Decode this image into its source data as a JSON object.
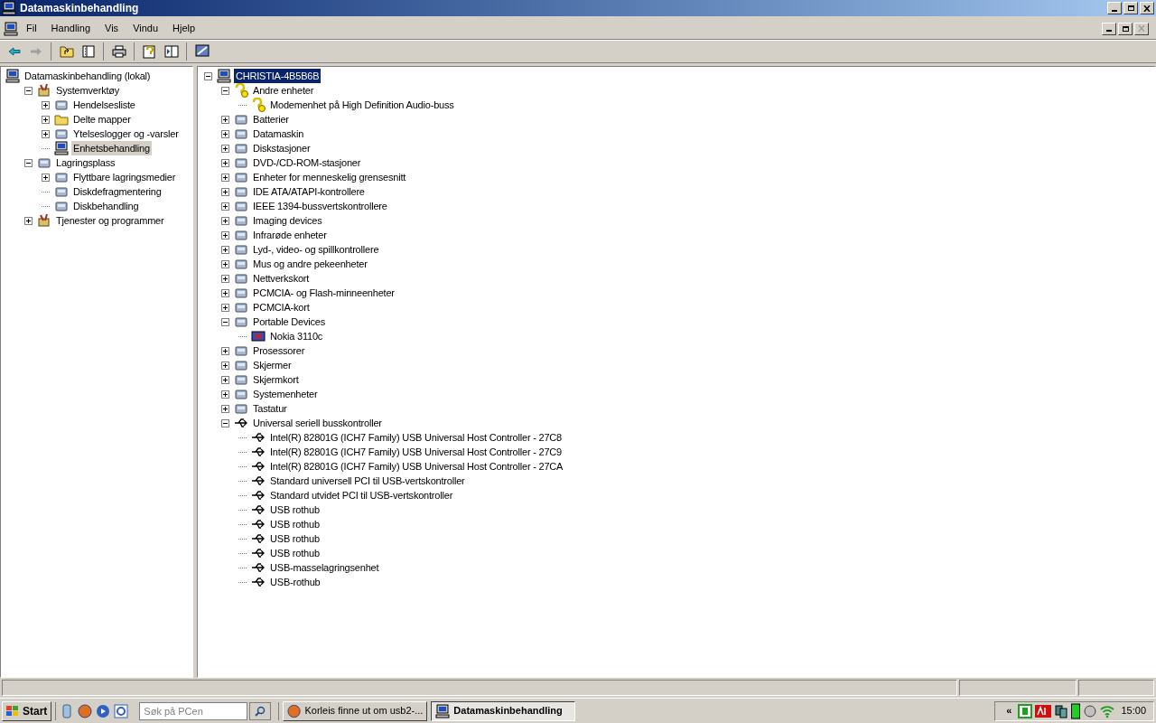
{
  "window": {
    "title": "Datamaskinbehandling"
  },
  "menu": [
    "Fil",
    "Handling",
    "Vis",
    "Vindu",
    "Hjelp"
  ],
  "left_tree": [
    {
      "label": "Datamaskinbehandling (lokal)",
      "kind": "computer",
      "selected": false,
      "children": [
        {
          "label": "Systemverktøy",
          "kind": "tools",
          "expanded": true,
          "selected": false,
          "children": [
            {
              "label": "Hendelsesliste",
              "kind": "device",
              "expanded": false,
              "selected": false
            },
            {
              "label": "Delte mapper",
              "kind": "folder",
              "expanded": false,
              "selected": false
            },
            {
              "label": "Ytelseslogger og -varsler",
              "kind": "device",
              "expanded": false,
              "selected": false
            },
            {
              "label": "Enhetsbehandling",
              "kind": "computer",
              "selected": true
            }
          ]
        },
        {
          "label": "Lagringsplass",
          "kind": "device",
          "expanded": true,
          "selected": false,
          "children": [
            {
              "label": "Flyttbare lagringsmedier",
              "kind": "device",
              "expanded": false,
              "selected": false
            },
            {
              "label": "Diskdefragmentering",
              "kind": "device",
              "selected": false
            },
            {
              "label": "Diskbehandling",
              "kind": "device",
              "selected": false
            }
          ]
        },
        {
          "label": "Tjenester og programmer",
          "kind": "tools",
          "expanded": false,
          "selected": false
        }
      ]
    }
  ],
  "right_tree": [
    {
      "label": "CHRISTIA-4B5B6B",
      "kind": "computer",
      "expanded": true,
      "selected": true,
      "children": [
        {
          "label": "Andre enheter",
          "kind": "warning",
          "expanded": true,
          "selected": false,
          "children": [
            {
              "label": "Modemenhet på High Definition Audio-buss",
              "kind": "warning",
              "selected": false
            }
          ]
        },
        {
          "label": "Batterier",
          "kind": "device",
          "expanded": false,
          "selected": false
        },
        {
          "label": "Datamaskin",
          "kind": "device",
          "expanded": false,
          "selected": false
        },
        {
          "label": "Diskstasjoner",
          "kind": "device",
          "expanded": false,
          "selected": false
        },
        {
          "label": "DVD-/CD-ROM-stasjoner",
          "kind": "device",
          "expanded": false,
          "selected": false
        },
        {
          "label": "Enheter for menneskelig grensesnitt",
          "kind": "device",
          "expanded": false,
          "selected": false
        },
        {
          "label": "IDE ATA/ATAPI-kontrollere",
          "kind": "device",
          "expanded": false,
          "selected": false
        },
        {
          "label": "IEEE 1394-bussvertskontrollere",
          "kind": "device",
          "expanded": false,
          "selected": false
        },
        {
          "label": "Imaging devices",
          "kind": "device",
          "expanded": false,
          "selected": false
        },
        {
          "label": "Infrarøde enheter",
          "kind": "device",
          "expanded": false,
          "selected": false
        },
        {
          "label": "Lyd-, video- og spillkontrollere",
          "kind": "device",
          "expanded": false,
          "selected": false
        },
        {
          "label": "Mus og andre pekeenheter",
          "kind": "device",
          "expanded": false,
          "selected": false
        },
        {
          "label": "Nettverkskort",
          "kind": "device",
          "expanded": false,
          "selected": false
        },
        {
          "label": "PCMCIA- og Flash-minneenheter",
          "kind": "device",
          "expanded": false,
          "selected": false
        },
        {
          "label": "PCMCIA-kort",
          "kind": "device",
          "expanded": false,
          "selected": false
        },
        {
          "label": "Portable Devices",
          "kind": "device",
          "expanded": true,
          "selected": false,
          "children": [
            {
              "label": "Nokia 3110c",
              "kind": "phone",
              "selected": false
            }
          ]
        },
        {
          "label": "Prosessorer",
          "kind": "device",
          "expanded": false,
          "selected": false
        },
        {
          "label": "Skjermer",
          "kind": "device",
          "expanded": false,
          "selected": false
        },
        {
          "label": "Skjermkort",
          "kind": "device",
          "expanded": false,
          "selected": false
        },
        {
          "label": "Systemenheter",
          "kind": "device",
          "expanded": false,
          "selected": false
        },
        {
          "label": "Tastatur",
          "kind": "device",
          "expanded": false,
          "selected": false
        },
        {
          "label": "Universal seriell busskontroller",
          "kind": "usb",
          "expanded": true,
          "selected": false,
          "children": [
            {
              "label": "Intel(R) 82801G (ICH7 Family) USB Universal Host Controller - 27C8",
              "kind": "usb",
              "selected": false
            },
            {
              "label": "Intel(R) 82801G (ICH7 Family) USB Universal Host Controller - 27C9",
              "kind": "usb",
              "selected": false
            },
            {
              "label": "Intel(R) 82801G (ICH7 Family) USB Universal Host Controller - 27CA",
              "kind": "usb",
              "selected": false
            },
            {
              "label": "Standard universell PCI til USB-vertskontroller",
              "kind": "usb",
              "selected": false
            },
            {
              "label": "Standard utvidet PCI til USB-vertskontroller",
              "kind": "usb",
              "selected": false
            },
            {
              "label": "USB rothub",
              "kind": "usb",
              "selected": false
            },
            {
              "label": "USB rothub",
              "kind": "usb",
              "selected": false
            },
            {
              "label": "USB rothub",
              "kind": "usb",
              "selected": false
            },
            {
              "label": "USB rothub",
              "kind": "usb",
              "selected": false
            },
            {
              "label": "USB-masselagringsenhet",
              "kind": "usb",
              "selected": false
            },
            {
              "label": "USB-rothub",
              "kind": "usb",
              "selected": false
            }
          ]
        }
      ]
    }
  ],
  "taskbar": {
    "start": "Start",
    "search": {
      "placeholder": "Søk på PCen"
    },
    "tasks": [
      {
        "label": "Korleis finne ut om usb2-...",
        "kind": "browser",
        "selected": false
      },
      {
        "label": "Datamaskinbehandling",
        "kind": "computer",
        "selected": true
      }
    ],
    "tray_chevron": "«",
    "clock": "15:00"
  }
}
